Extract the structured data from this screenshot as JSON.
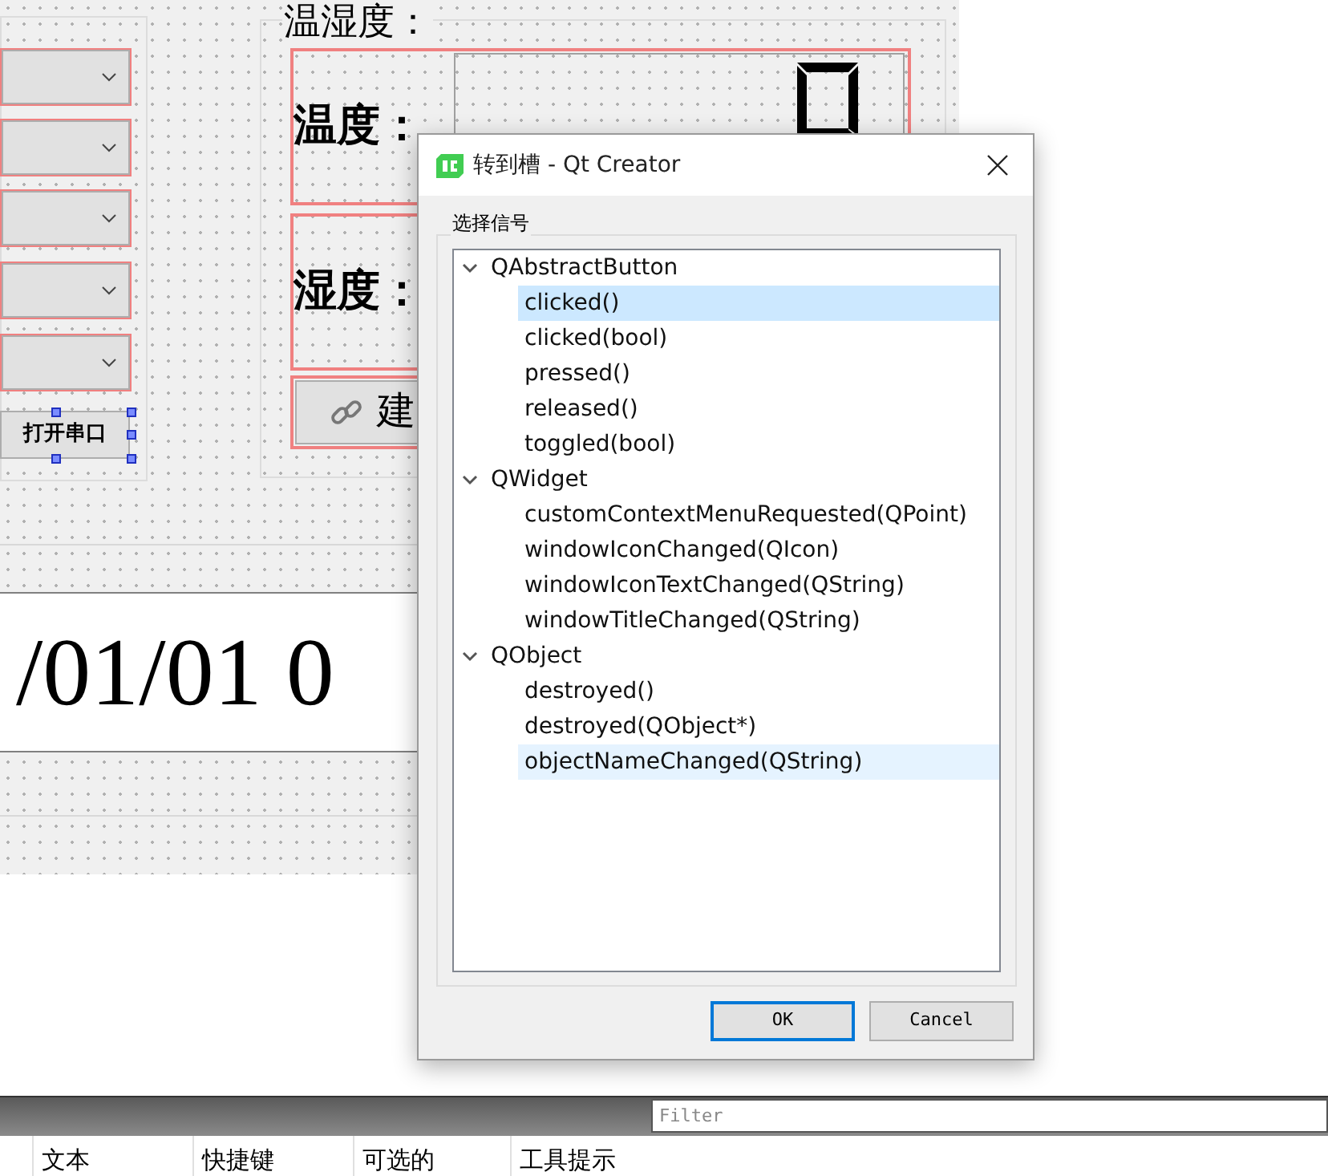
{
  "form": {
    "open_port_button": "打开串口",
    "group_title": "温湿度：",
    "temperature_label": "温度：",
    "humidity_label": "湿度：",
    "connect_button": "建",
    "datetime": "/01/01 0"
  },
  "dialog": {
    "title": "转到槽 - Qt Creator",
    "group_label": "选择信号",
    "tree": [
      {
        "label": "QAbstractButton",
        "expanded": true,
        "children": [
          {
            "label": "clicked()",
            "selected": true,
            "hovered": false
          },
          {
            "label": "clicked(bool)",
            "selected": false,
            "hovered": false
          },
          {
            "label": "pressed()",
            "selected": false,
            "hovered": false
          },
          {
            "label": "released()",
            "selected": false,
            "hovered": false
          },
          {
            "label": "toggled(bool)",
            "selected": false,
            "hovered": false
          }
        ]
      },
      {
        "label": "QWidget",
        "expanded": true,
        "children": [
          {
            "label": "customContextMenuRequested(QPoint)",
            "selected": false,
            "hovered": false
          },
          {
            "label": "windowIconChanged(QIcon)",
            "selected": false,
            "hovered": false
          },
          {
            "label": "windowIconTextChanged(QString)",
            "selected": false,
            "hovered": false
          },
          {
            "label": "windowTitleChanged(QString)",
            "selected": false,
            "hovered": false
          }
        ]
      },
      {
        "label": "QObject",
        "expanded": true,
        "children": [
          {
            "label": "destroyed()",
            "selected": false,
            "hovered": false
          },
          {
            "label": "destroyed(QObject*)",
            "selected": false,
            "hovered": false
          },
          {
            "label": "objectNameChanged(QString)",
            "selected": false,
            "hovered": true
          }
        ]
      }
    ],
    "buttons": [
      {
        "label": "OK",
        "default": true
      },
      {
        "label": "Cancel",
        "default": false
      }
    ]
  },
  "filter": {
    "placeholder": "Filter"
  },
  "columns": [
    "文本",
    "快捷键",
    "可选的",
    "工具提示"
  ]
}
